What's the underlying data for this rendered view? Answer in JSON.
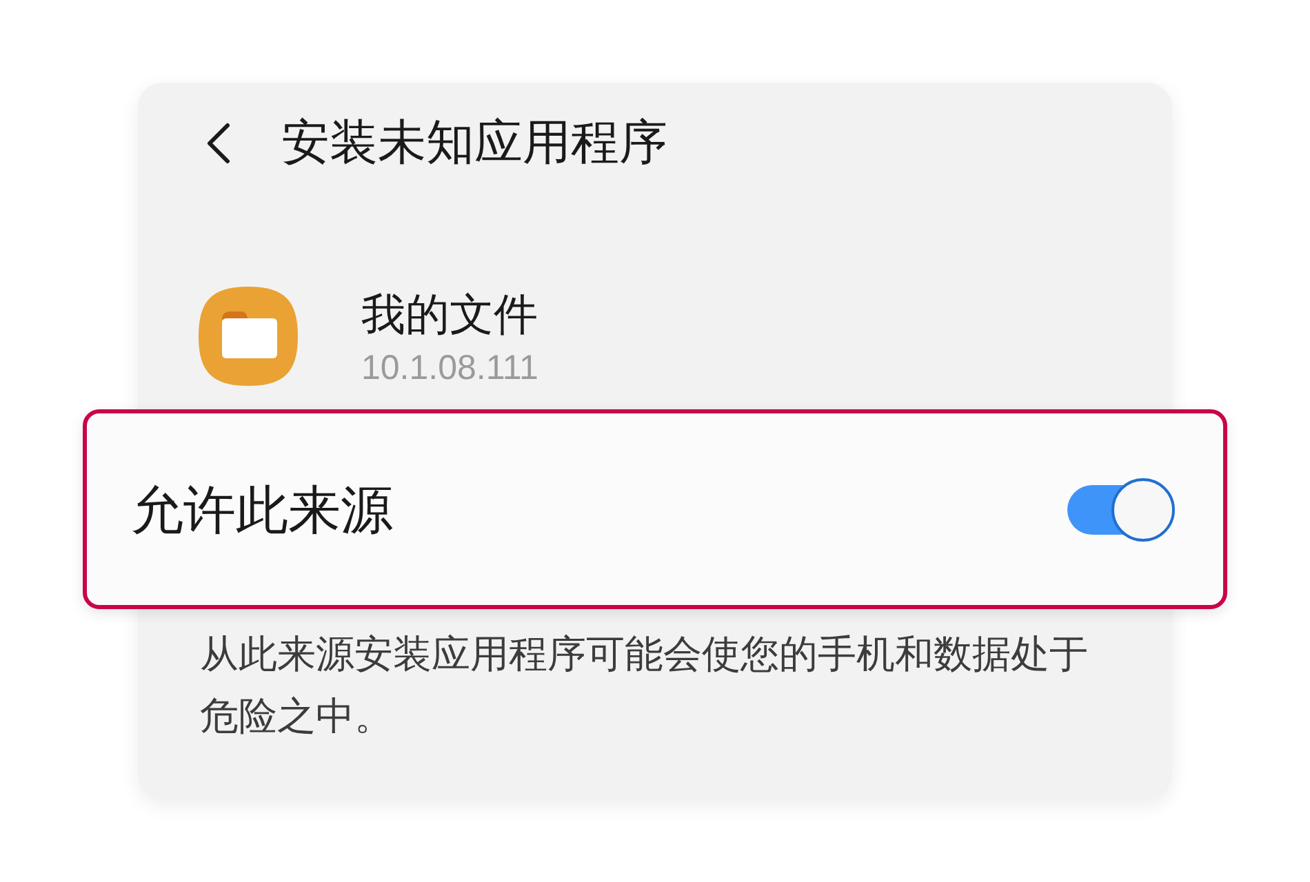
{
  "header": {
    "title": "安装未知应用程序"
  },
  "app": {
    "name": "我的文件",
    "version": "10.1.08.111"
  },
  "setting": {
    "label": "允许此来源",
    "on": true,
    "highlighted": true
  },
  "description": "从此来源安装应用程序可能会使您的手机和数据处于危险之中。"
}
